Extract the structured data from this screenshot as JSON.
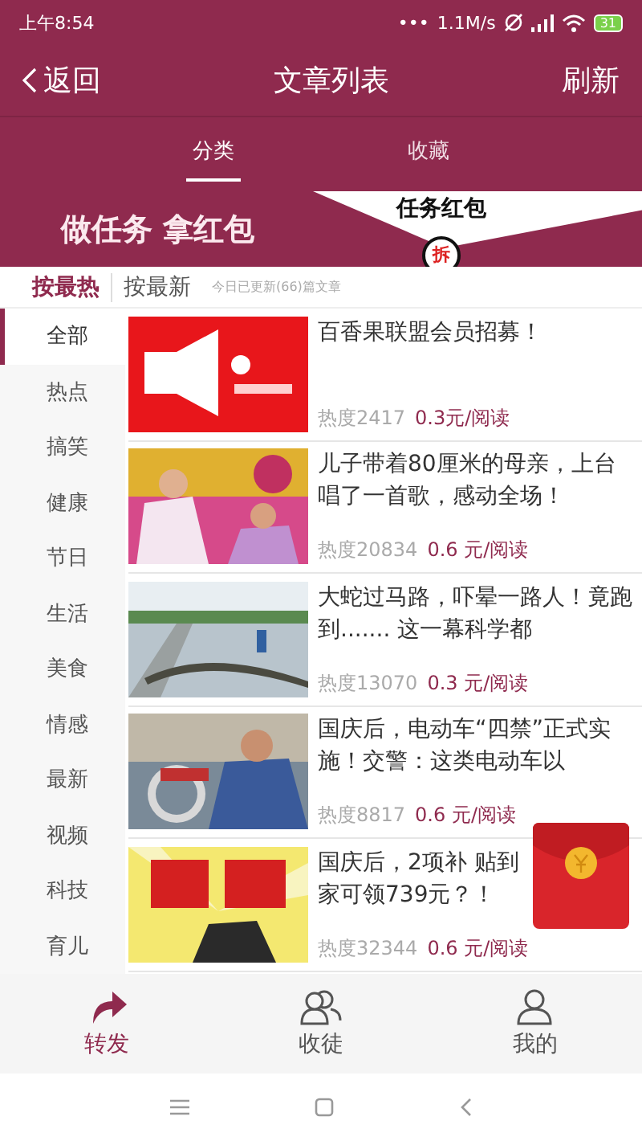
{
  "status_bar": {
    "time": "上午8:54",
    "dots": "•••",
    "speed": "1.1M/s",
    "battery": "31"
  },
  "header": {
    "back": "返回",
    "title": "文章列表",
    "action": "刷新"
  },
  "tabs": [
    {
      "label": "分类",
      "selected": true
    },
    {
      "label": "收藏",
      "selected": false
    }
  ],
  "banner": {
    "text": "做任务 拿红包",
    "envelope_title": "任务红包",
    "envelope_seal": "拆"
  },
  "sort": {
    "options": [
      {
        "label": "按最热",
        "selected": true
      },
      {
        "label": "按最新",
        "selected": false
      }
    ],
    "note": "今日已更新(66)篇文章"
  },
  "categories": [
    {
      "label": "全部",
      "selected": true
    },
    {
      "label": "热点",
      "selected": false
    },
    {
      "label": "搞笑",
      "selected": false
    },
    {
      "label": "健康",
      "selected": false
    },
    {
      "label": "节日",
      "selected": false
    },
    {
      "label": "生活",
      "selected": false
    },
    {
      "label": "美食",
      "selected": false
    },
    {
      "label": "情感",
      "selected": false
    },
    {
      "label": "最新",
      "selected": false
    },
    {
      "label": "视频",
      "selected": false
    },
    {
      "label": "科技",
      "selected": false
    },
    {
      "label": "育儿",
      "selected": false
    }
  ],
  "articles": [
    {
      "title": "百香果联盟会员招募！",
      "heat": "热度2417",
      "reward": "0.3元/阅读"
    },
    {
      "title": "儿子带着80厘米的母亲，上台唱了一首歌，感动全场！",
      "heat": "热度20834",
      "reward": "0.6 元/阅读"
    },
    {
      "title": "大蛇过马路，吓晕一路人！竟跑到....... 这一幕科学都",
      "heat": "热度13070",
      "reward": "0.3 元/阅读"
    },
    {
      "title": "国庆后，电动车“四禁”正式实施！交警：这类电动车以",
      "heat": "热度8817",
      "reward": "0.6 元/阅读"
    },
    {
      "title": "国庆后，2项补 贴到家可领739元？！",
      "heat": "热度32344",
      "reward": "0.6 元/阅读"
    }
  ],
  "bottom_nav": [
    {
      "label": "转发",
      "selected": true
    },
    {
      "label": "收徒",
      "selected": false
    },
    {
      "label": "我的",
      "selected": false
    }
  ]
}
